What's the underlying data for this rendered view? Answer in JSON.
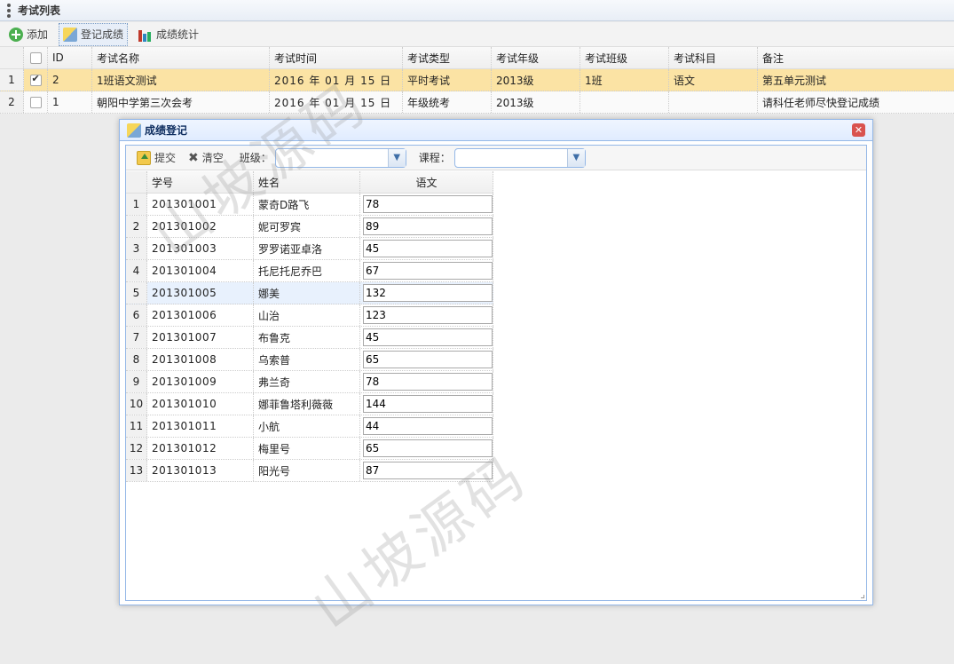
{
  "panel": {
    "title": "考试列表"
  },
  "toolbar": {
    "add": "添加",
    "register": "登记成绩",
    "stats": "成绩统计"
  },
  "exam_grid": {
    "headers": [
      "ID",
      "考试名称",
      "考试时间",
      "考试类型",
      "考试年级",
      "考试班级",
      "考试科目",
      "备注"
    ],
    "rows": [
      {
        "num": "1",
        "checked": true,
        "id": "2",
        "name": "1班语文测试",
        "time": "2016 年 01 月 15 日",
        "type": "平时考试",
        "grade": "2013级",
        "class": "1班",
        "subject": "语文",
        "note": "第五单元测试"
      },
      {
        "num": "2",
        "checked": false,
        "id": "1",
        "name": "朝阳中学第三次会考",
        "time": "2016 年 01 月 15 日",
        "type": "年级统考",
        "grade": "2013级",
        "class": "",
        "subject": "",
        "note": "请科任老师尽快登记成绩"
      }
    ]
  },
  "dialog": {
    "title": "成绩登记",
    "submit": "提交",
    "clear": "清空",
    "class_label": "班级：",
    "course_label": "课程：",
    "class_value": "",
    "course_value": "",
    "headers": [
      "学号",
      "姓名",
      "语文"
    ],
    "students": [
      {
        "num": "1",
        "id": "201301001",
        "name": "蒙奇D路飞",
        "score": "78"
      },
      {
        "num": "2",
        "id": "201301002",
        "name": "妮可罗宾",
        "score": "89"
      },
      {
        "num": "3",
        "id": "201301003",
        "name": "罗罗诺亚卓洛",
        "score": "45"
      },
      {
        "num": "4",
        "id": "201301004",
        "name": "托尼托尼乔巴",
        "score": "67"
      },
      {
        "num": "5",
        "id": "201301005",
        "name": "娜美",
        "score": "132"
      },
      {
        "num": "6",
        "id": "201301006",
        "name": "山治",
        "score": "123"
      },
      {
        "num": "7",
        "id": "201301007",
        "name": "布鲁克",
        "score": "45"
      },
      {
        "num": "8",
        "id": "201301008",
        "name": "乌索普",
        "score": "65"
      },
      {
        "num": "9",
        "id": "201301009",
        "name": "弗兰奇",
        "score": "78"
      },
      {
        "num": "10",
        "id": "201301010",
        "name": "娜菲鲁塔利薇薇",
        "score": "144"
      },
      {
        "num": "11",
        "id": "201301011",
        "name": "小航",
        "score": "44"
      },
      {
        "num": "12",
        "id": "201301012",
        "name": "梅里号",
        "score": "65"
      },
      {
        "num": "13",
        "id": "201301013",
        "name": "阳光号",
        "score": "87"
      }
    ]
  },
  "watermark": "山坡源码"
}
